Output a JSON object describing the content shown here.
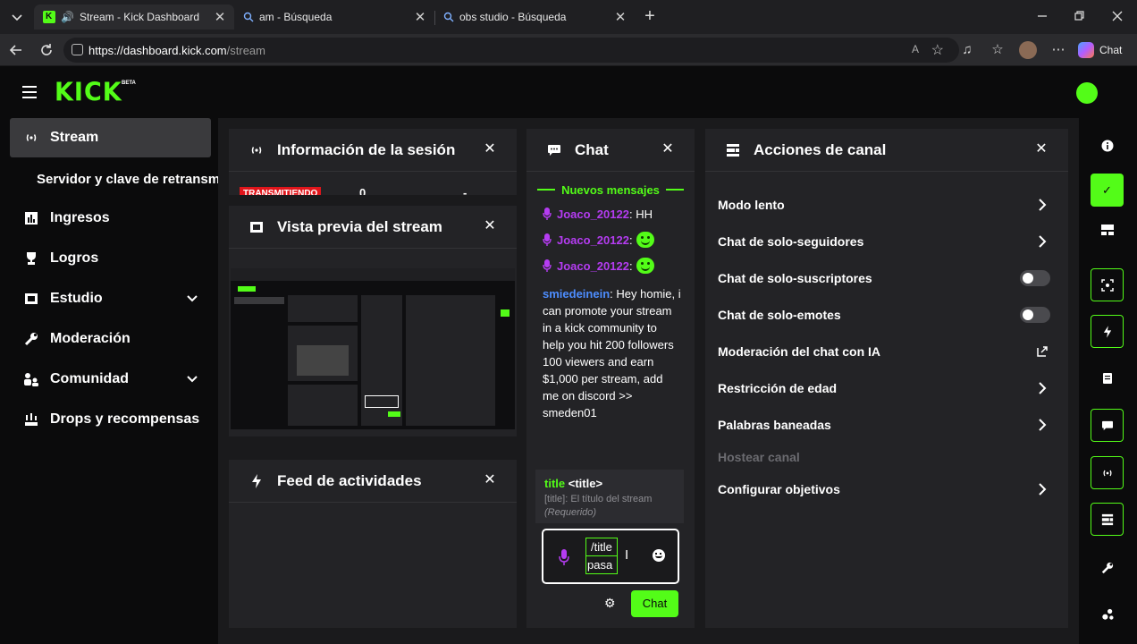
{
  "browser": {
    "tabs": [
      {
        "title": "Stream - Kick Dashboard",
        "active": true
      },
      {
        "title": "am - Búsqueda",
        "active": false
      },
      {
        "title": "obs studio - Búsqueda",
        "active": false
      }
    ],
    "url_host": "https://dashboard.kick.com",
    "url_path": "/stream",
    "copilot_label": "Chat"
  },
  "header": {
    "logo": "KICK",
    "beta": "BETA"
  },
  "sidebar": {
    "items": [
      {
        "label": "Stream"
      },
      {
        "label": "Servidor y clave de retransmisión"
      },
      {
        "label": "Ingresos"
      },
      {
        "label": "Logros"
      },
      {
        "label": "Estudio"
      },
      {
        "label": "Moderación"
      },
      {
        "label": "Comunidad"
      },
      {
        "label": "Drops y recompensas"
      }
    ]
  },
  "session": {
    "title": "Información de la sesión",
    "status_badge": "TRANSMITIENDO",
    "value_a": "0",
    "value_b": "-"
  },
  "preview": {
    "title": "Vista previa del stream"
  },
  "feed": {
    "title": "Feed de actividades"
  },
  "chat": {
    "title": "Chat",
    "new_messages": "Nuevos mensajes",
    "messages": [
      {
        "user": "Joaco_20122",
        "text": "HH"
      },
      {
        "user": "Joaco_20122",
        "text": ""
      },
      {
        "user": "Joaco_20122",
        "text": ""
      },
      {
        "user": "smiedeinein",
        "text": "Hey homie, i can promote your stream in a kick community to help you hit 200 followers 100 viewers and earn $1,000 per stream, add me on discord >> smeden01"
      }
    ],
    "command": {
      "name": "title",
      "arg": "<title>",
      "desc_key": "[title]:",
      "desc": "El título del stream",
      "required": "(Requerido)"
    },
    "input_line1": "/title",
    "input_line2": "pasa",
    "send_label": "Chat",
    "colors": {
      "user_purple": "#b53cf2",
      "user_blue": "#4d8dff",
      "accent": "#53fc18"
    }
  },
  "actions": {
    "title": "Acciones de canal",
    "items": [
      {
        "label": "Modo lento",
        "control": "chevron"
      },
      {
        "label": "Chat de solo-seguidores",
        "control": "chevron"
      },
      {
        "label": "Chat de solo-suscriptores",
        "control": "toggle-off"
      },
      {
        "label": "Chat de solo-emotes",
        "control": "toggle-off"
      },
      {
        "label": "Moderación del chat con IA",
        "control": "external"
      },
      {
        "label": "Restricción de edad",
        "control": "chevron"
      },
      {
        "label": "Palabras baneadas",
        "control": "chevron"
      },
      {
        "label": "Hostear canal",
        "control": "disabled"
      },
      {
        "label": "Configurar objetivos",
        "control": "chevron"
      }
    ]
  }
}
